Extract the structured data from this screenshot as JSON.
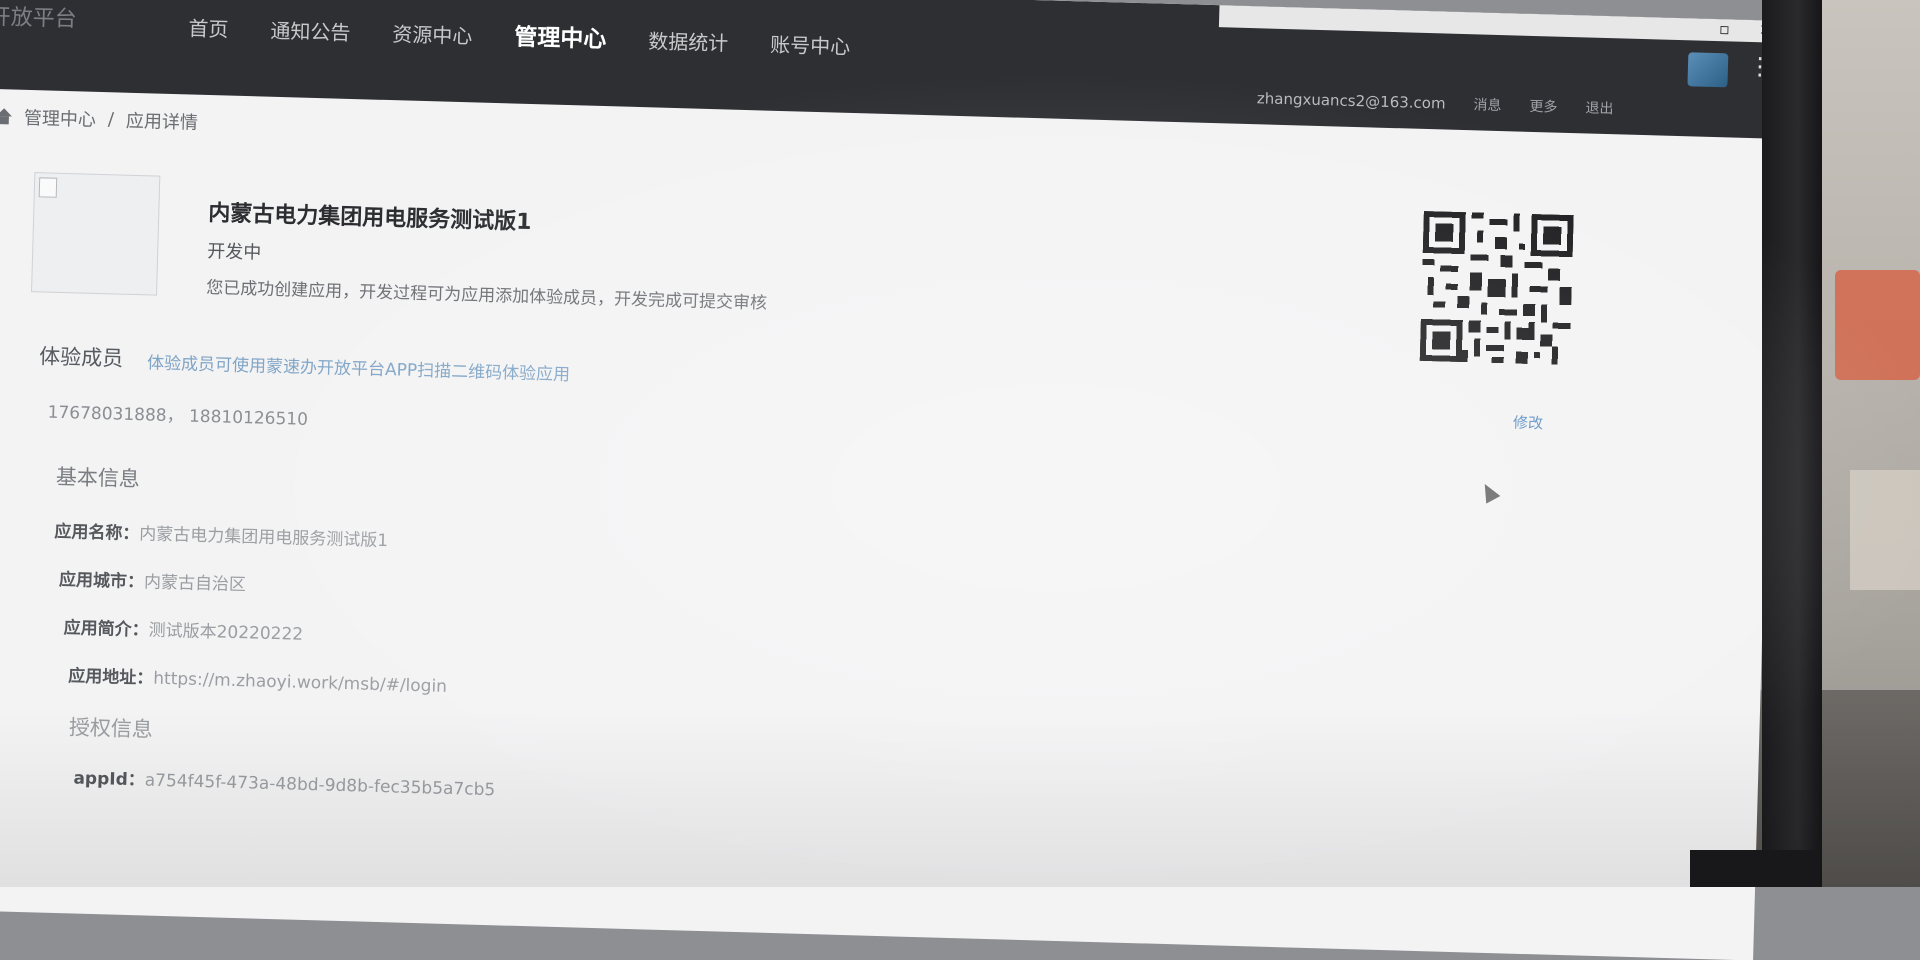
{
  "header": {
    "brand": "开放平台",
    "nav": [
      "首页",
      "通知公告",
      "资源中心",
      "管理中心",
      "数据统计",
      "账号中心"
    ],
    "active_nav": "管理中心",
    "user_email": "zhangxuancs2@163.com",
    "links": [
      "消息",
      "更多",
      "退出"
    ]
  },
  "breadcrumb": {
    "root": "管理中心",
    "sep": "/",
    "current": "应用详情"
  },
  "app": {
    "name": "内蒙古电力集团用电服务测试版1",
    "status": "开发中",
    "message": "您已成功创建应用，开发过程可为应用添加体验成员，开发完成可提交审核"
  },
  "testers": {
    "heading": "体验成员",
    "desc": "体验成员可使用蒙速办开放平台APP扫描二维码体验应用",
    "phones": "17678031888，  18810126510",
    "edit_label": "修改"
  },
  "basic_info": {
    "heading": "基本信息",
    "rows": [
      {
        "label": "应用名称：",
        "value": "内蒙古电力集团用电服务测试版1"
      },
      {
        "label": "应用城市：",
        "value": "内蒙古自治区"
      },
      {
        "label": "应用简介：",
        "value": "测试版本20220222"
      },
      {
        "label": "应用地址：",
        "value": "https://m.zhaoyi.work/msb/#/login"
      }
    ]
  },
  "auth_info": {
    "heading": "授权信息",
    "appid_label": "appId：",
    "appid_value": "a754f45f-473a-48bd-9d8b-fec35b5a7cb5"
  },
  "icons": [
    "home-icon",
    "qr-code-icon",
    "broken-image-icon",
    "mouse-cursor-icon",
    "extension-icon",
    "kebab-menu-icon"
  ]
}
